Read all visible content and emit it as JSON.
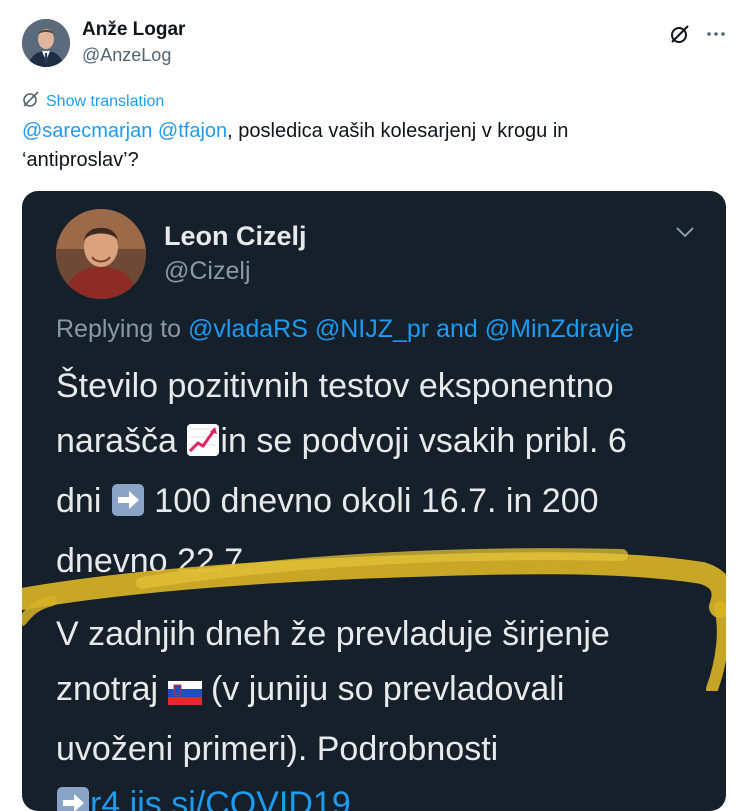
{
  "author": {
    "name": "Anže Logar",
    "handle": "@AnzeLog"
  },
  "icons": {
    "grok": "slash-circle-icon",
    "more": "more-horizontal-icon",
    "translate": "translate-icon",
    "quote_menu": "chevron-down-icon",
    "chart_emoji": "chart-increasing-emoji",
    "arrow_emoji": "right-arrow-emoji",
    "flag_emoji": "slovenia-flag-emoji"
  },
  "translation_link": "Show translation",
  "tweet": {
    "mention1": "@sarecmarjan",
    "mention2": "@tfajon",
    "text_line1": ", posledica vaših kolesarjenj v krogu in",
    "text_line2": "‘antiproslav’?"
  },
  "quoted": {
    "name": "Leon Cizelj",
    "handle": "@Cizelj",
    "replying_to": "Replying to",
    "reply_m1": "@vladaRS",
    "reply_m2": "@NIJZ_pr",
    "reply_and": "and",
    "reply_m3": "@MinZdravje",
    "p1_a": "Število pozitivnih testov eksponentno",
    "p1_b": "narašča",
    "p1_c": "in se podvoji vsakih pribl. 6",
    "p1_d": "dni",
    "p1_e": "100 dnevno okoli 16.7. in 200",
    "p1_f": "dnevno 22.7.",
    "p2_a": "V zadnjih dneh že prevladuje širjenje",
    "p2_b": "znotraj",
    "p2_c": "(v juniju so prevladovali",
    "p2_d": "uvoženi primeri). Podrobnosti",
    "link": "r4.jis.si/COVID19"
  },
  "colors": {
    "link": "#1d9bf0",
    "card_bg": "#15202b",
    "highlight": "#d8b327"
  }
}
